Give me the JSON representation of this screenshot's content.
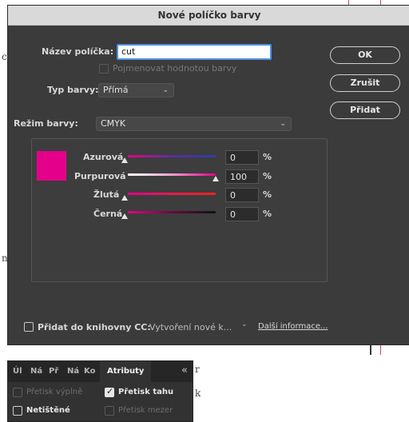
{
  "dialog": {
    "title": "Nové políčko barvy",
    "name_label": "Název políčka:",
    "name_value": "cut",
    "name_by_value_label": "Pojmenovat hodnotou barvy",
    "color_type_label": "Typ barvy:",
    "color_type_value": "Přímá",
    "color_mode_label": "Režim barvy:",
    "color_mode_value": "CMYK",
    "buttons": {
      "ok": "OK",
      "cancel": "Zrušit",
      "add": "Přidat"
    },
    "swatch_color": "#e4008a",
    "sliders": [
      {
        "label": "Azurová",
        "value": "0",
        "unit": "%"
      },
      {
        "label": "Purpurová",
        "value": "100",
        "unit": "%"
      },
      {
        "label": "Žlutá",
        "value": "0",
        "unit": "%"
      },
      {
        "label": "Černá",
        "value": "0",
        "unit": "%"
      }
    ],
    "library_label": "Přidat do knihovny CC:",
    "library_value": "Vytvoření nové k...",
    "more_info_link": "Další informace..."
  },
  "attributes_panel": {
    "tabs": [
      "Úl",
      "Ná",
      "Př",
      "Ná",
      "Ko"
    ],
    "active_tab": "Atributy",
    "collapse_icon": "«",
    "options": [
      {
        "label": "Přetisk výplně",
        "checked": false,
        "enabled": false
      },
      {
        "label": "Přetisk tahu",
        "checked": true,
        "enabled": true
      },
      {
        "label": "Netištěné",
        "checked": false,
        "enabled": true
      },
      {
        "label": "Přetisk mezer",
        "checked": false,
        "enabled": false
      }
    ]
  },
  "background_text": [
    "c",
    "n",
    "r",
    "k"
  ],
  "colors": {
    "dialog_bg": "#3b3b3b",
    "title_bar": "#d9d9d9",
    "focus_blue": "#4a90e2",
    "magenta": "#e4008a"
  }
}
